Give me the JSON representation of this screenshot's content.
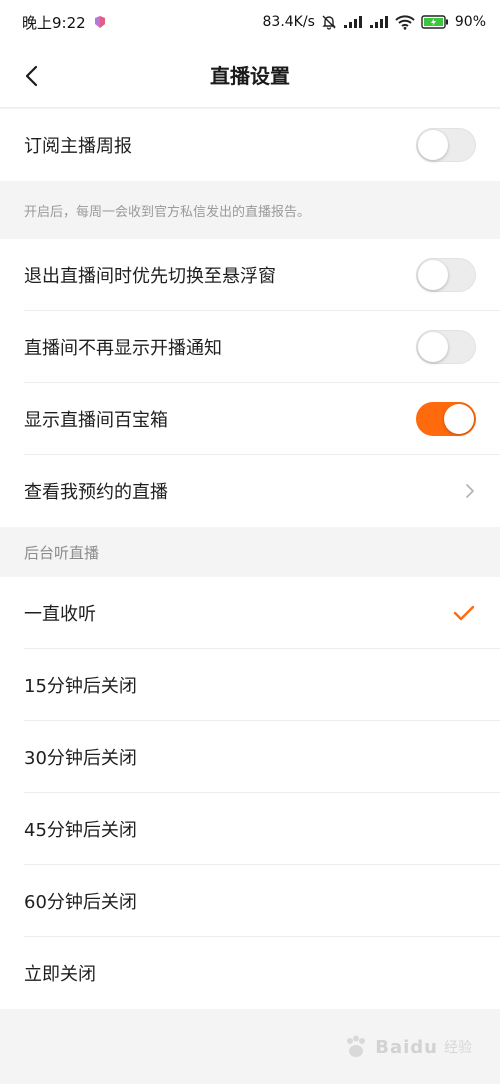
{
  "status_bar": {
    "time": "晚上9:22",
    "network_speed": "83.4K/s",
    "battery": "90%"
  },
  "header": {
    "title": "直播设置"
  },
  "section_one": {
    "subscribe_label": "订阅主播周报",
    "subscribe_on": false,
    "hint": "开启后，每周一会收到官方私信发出的直播报告。"
  },
  "section_two": {
    "items": [
      {
        "label": "退出直播间时优先切换至悬浮窗",
        "on": false
      },
      {
        "label": "直播间不再显示开播通知",
        "on": false
      },
      {
        "label": "显示直播间百宝箱",
        "on": true
      }
    ],
    "reservations_label": "查看我预约的直播"
  },
  "background_listen": {
    "header": "后台听直播",
    "options": [
      {
        "label": "一直收听",
        "selected": true
      },
      {
        "label": "15分钟后关闭",
        "selected": false
      },
      {
        "label": "30分钟后关闭",
        "selected": false
      },
      {
        "label": "45分钟后关闭",
        "selected": false
      },
      {
        "label": "60分钟后关闭",
        "selected": false
      },
      {
        "label": "立即关闭",
        "selected": false
      }
    ]
  },
  "watermark": {
    "text": "Baidu",
    "sub": "经验"
  },
  "colors": {
    "accent": "#ff6a0c",
    "battery_green": "#3ec43e"
  },
  "icons": {
    "back": "chevron-left-icon",
    "chevron": "chevron-right-icon",
    "check": "checkmark-icon"
  }
}
